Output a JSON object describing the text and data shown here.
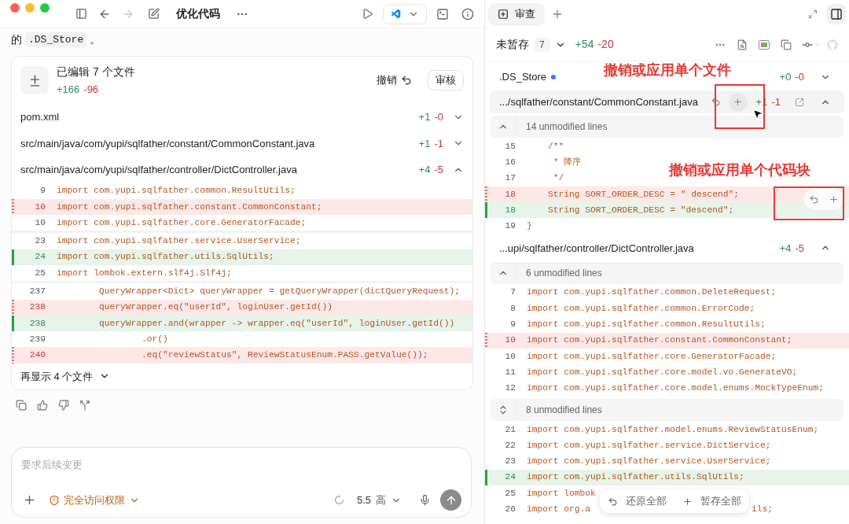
{
  "window": {
    "title": "优化代码",
    "forward_disabled": true
  },
  "message": {
    "prefix": "的",
    "code": ".DS_Store",
    "suffix": "。"
  },
  "edit_card": {
    "title": "已编辑 7 个文件",
    "added": "+166",
    "removed": "-96",
    "undo_label": "撤销",
    "review_label": "审核",
    "files": [
      {
        "path": "pom.xml",
        "added": "+1",
        "removed": "-0",
        "expanded": false
      },
      {
        "path": "src/main/java/com/yupi/sqlfather/constant/CommonConstant.java",
        "added": "+1",
        "removed": "-1",
        "expanded": false
      },
      {
        "path": "src/main/java/com/yupi/sqlfather/controller/DictController.java",
        "added": "+4",
        "removed": "-5",
        "expanded": true
      }
    ],
    "hunks": [
      [
        {
          "num": "9",
          "text": "import com.yupi.sqlfather.common.ResultUtils;",
          "kind": "context"
        },
        {
          "num": "10",
          "text": "import com.yupi.sqlfather.constant.CommonConstant;",
          "kind": "removed"
        },
        {
          "num": "10",
          "text": "import com.yupi.sqlfather.core.GeneratorFacade;",
          "kind": "context"
        }
      ],
      [
        {
          "num": "23",
          "text": "import com.yupi.sqlfather.service.UserService;",
          "kind": "context"
        },
        {
          "num": "24",
          "text": "import com.yupi.sqlfather.utils.SqlUtils;",
          "kind": "added"
        },
        {
          "num": "25",
          "text": "import lombok.extern.slf4j.Slf4j;",
          "kind": "context"
        }
      ],
      [
        {
          "num": "237",
          "text": "        QueryWrapper<Dict> queryWrapper = getQueryWrapper(dictQueryRequest);",
          "kind": "context"
        },
        {
          "num": "238",
          "text": "        queryWrapper.eq(\"userId\", loginUser.getId())",
          "kind": "removed"
        },
        {
          "num": "238",
          "text": "        queryWrapper.and(wrapper -> wrapper.eq(\"userId\", loginUser.getId())",
          "kind": "added"
        },
        {
          "num": "239",
          "text": "                .or()",
          "kind": "context"
        },
        {
          "num": "240",
          "text": "                .eq(\"reviewStatus\", ReviewStatusEnum.PASS.getValue());",
          "kind": "removed"
        }
      ]
    ],
    "show_more": "再显示 4 个文件"
  },
  "composer": {
    "placeholder": "要求后续变更",
    "access": "完全访问权限",
    "model": "5.5",
    "effort": "高"
  },
  "review": {
    "tabs": [
      {
        "label": "审查",
        "selected": true
      }
    ],
    "panel_selected": true,
    "unstaged": {
      "label": "未暂存",
      "count": "7",
      "added": "+54",
      "removed": "-20"
    },
    "files": [
      {
        "name": ".DS_Store",
        "modified": true,
        "added": "+0",
        "removed": "-0",
        "expanded": false,
        "selected": false
      },
      {
        "name": ".../sqlfather/constant/CommonConstant.java",
        "modified": false,
        "added": "+1",
        "removed": "-1",
        "expanded": true,
        "selected": true,
        "blocks": [
          {
            "kind": "fold",
            "label": "14 unmodified lines",
            "bidirectional": false
          },
          {
            "kind": "lines",
            "hunk_actions": true,
            "lines": [
              {
                "num": "15",
                "text": "    /**",
                "kind": "context"
              },
              {
                "num": "16",
                "text": "     * 降序",
                "kind": "context"
              },
              {
                "num": "17",
                "text": "     */",
                "kind": "context"
              },
              {
                "num": "18",
                "text": "    String SORT_ORDER_DESC = \" descend\";",
                "kind": "removed"
              },
              {
                "num": "18",
                "text": "    String SORT_ORDER_DESC = \"descend\";",
                "kind": "added"
              },
              {
                "num": "19",
                "text": "}",
                "kind": "context"
              }
            ]
          }
        ]
      },
      {
        "name": "...upi/sqlfather/controller/DictController.java",
        "modified": false,
        "added": "+4",
        "removed": "-5",
        "expanded": true,
        "selected": false,
        "blocks": [
          {
            "kind": "fold",
            "label": "6 unmodified lines",
            "bidirectional": false
          },
          {
            "kind": "lines",
            "lines": [
              {
                "num": "7",
                "text": "import com.yupi.sqlfather.common.DeleteRequest;",
                "kind": "context"
              },
              {
                "num": "8",
                "text": "import com.yupi.sqlfather.common.ErrorCode;",
                "kind": "context"
              },
              {
                "num": "9",
                "text": "import com.yupi.sqlfather.common.ResultUtils;",
                "kind": "context"
              },
              {
                "num": "10",
                "text": "import com.yupi.sqlfather.constant.CommonConstant;",
                "kind": "removed"
              },
              {
                "num": "10",
                "text": "import com.yupi.sqlfather.core.GeneratorFacade;",
                "kind": "context"
              },
              {
                "num": "11",
                "text": "import com.yupi.sqlfather.core.model.vo.GenerateVO;",
                "kind": "context"
              },
              {
                "num": "12",
                "text": "import com.yupi.sqlfather.core.model.enums.MockTypeEnum;",
                "kind": "context"
              }
            ]
          },
          {
            "kind": "fold",
            "label": "8 unmodified lines",
            "bidirectional": true
          },
          {
            "kind": "lines",
            "lines": [
              {
                "num": "21",
                "text": "import com.yupi.sqlfather.model.enums.ReviewStatusEnum;",
                "kind": "context"
              },
              {
                "num": "22",
                "text": "import com.yupi.sqlfather.service.DictService;",
                "kind": "context"
              },
              {
                "num": "23",
                "text": "import com.yupi.sqlfather.service.UserService;",
                "kind": "context"
              },
              {
                "num": "24",
                "text": "import com.yupi.sqlfather.utils.SqlUtils;",
                "kind": "added"
              },
              {
                "num": "25",
                "text": "import lombok",
                "kind": "context"
              },
              {
                "num": "26",
                "text": "import org.a",
                "tail": "ils;",
                "kind": "context"
              }
            ]
          }
        ]
      }
    ],
    "bulk": {
      "revert": "还原全部",
      "stage": "暂存全部"
    }
  },
  "annotations": [
    {
      "text": "撤销或应用单个文件"
    },
    {
      "text": "撤销或应用单个代码块"
    }
  ]
}
